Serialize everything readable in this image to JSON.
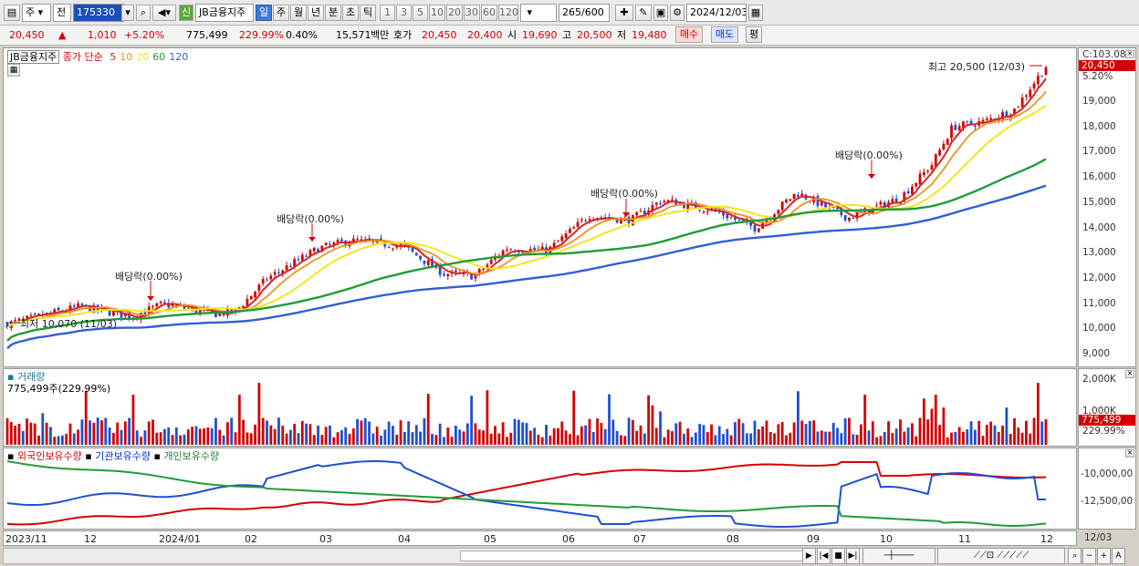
{
  "toolbar": {
    "market_select": "주",
    "prev_label": "전",
    "code": "175330",
    "stock_name": "JB금융지주",
    "new_label": "신",
    "period_tabs": [
      "일",
      "주",
      "월",
      "년",
      "분",
      "초",
      "틱"
    ],
    "period_numbers": [
      "1",
      "3",
      "5",
      "10",
      "20",
      "30",
      "60",
      "120"
    ],
    "count_value": "265",
    "count_total": "/600",
    "date": "2024/12/03"
  },
  "quote": {
    "price": "20,450",
    "change": "1,010",
    "change_pct": "+5.20%",
    "volume": "775,499",
    "vol_ratio": "229.99%",
    "turnover_ratio": "0.40%",
    "amount": "15,571",
    "amount_unit": "백만",
    "ask_label": "호가",
    "ask": "20,450",
    "bid": "20,400",
    "open_label": "시",
    "open": "19,690",
    "high_label": "고",
    "high": "20,500",
    "low_label": "저",
    "low": "19,480",
    "buy_label": "매수",
    "sell_label": "매도",
    "eval_label": "평"
  },
  "price_panel": {
    "stock_name": "JB금융지주",
    "ma_title": "종가 단순",
    "ma_periods": [
      "5",
      "10",
      "20",
      "60",
      "120"
    ],
    "axis_top": "C:103.08",
    "price_tag": "20,450",
    "pct_tag": "5.20%",
    "y_ticks": [
      "19,000",
      "18,000",
      "17,000",
      "16,000",
      "15,000",
      "14,000",
      "13,000",
      "12,000",
      "11,000",
      "10,000",
      "9,000"
    ],
    "high_annotation": "최고 20,500 (12/03)",
    "low_annotation": "최저 10,070 (11/03)",
    "dividend_labels": [
      "배당락(0.00%)",
      "배당락(0.00%)",
      "배당락(0.00%)",
      "배당락(0.00%)"
    ]
  },
  "volume_panel": {
    "title": "거래량",
    "current": "775,499주(229.99%)",
    "y_ticks": [
      "2,000K",
      "1,000K"
    ],
    "vol_tag": "775,499",
    "pct_tag": "229.99%"
  },
  "holding_panel": {
    "legend": [
      "외국인보유수량",
      "기관보유수량",
      "개인보유수량"
    ],
    "y_ticks": [
      "-10,000,00",
      "-12,500,00"
    ]
  },
  "x_axis": {
    "labels": [
      "2023/11",
      "12",
      "2024/01",
      "02",
      "03",
      "04",
      "05",
      "06",
      "07",
      "08",
      "09",
      "10",
      "11",
      "12"
    ],
    "end_label": "12/03"
  },
  "colors": {
    "ma5": "#d62728",
    "ma10": "#e8961e",
    "ma20": "#f2e51f",
    "ma60": "#1f9b3a",
    "ma120": "#2f5fd6",
    "up": "#d40000",
    "down": "#1f4fd0"
  },
  "chart_data": {
    "type": "candlestick",
    "y_range": [
      8600,
      21000
    ],
    "ma_periods": [
      5,
      10,
      20,
      60,
      120
    ],
    "high": 20500,
    "low": 10070
  }
}
